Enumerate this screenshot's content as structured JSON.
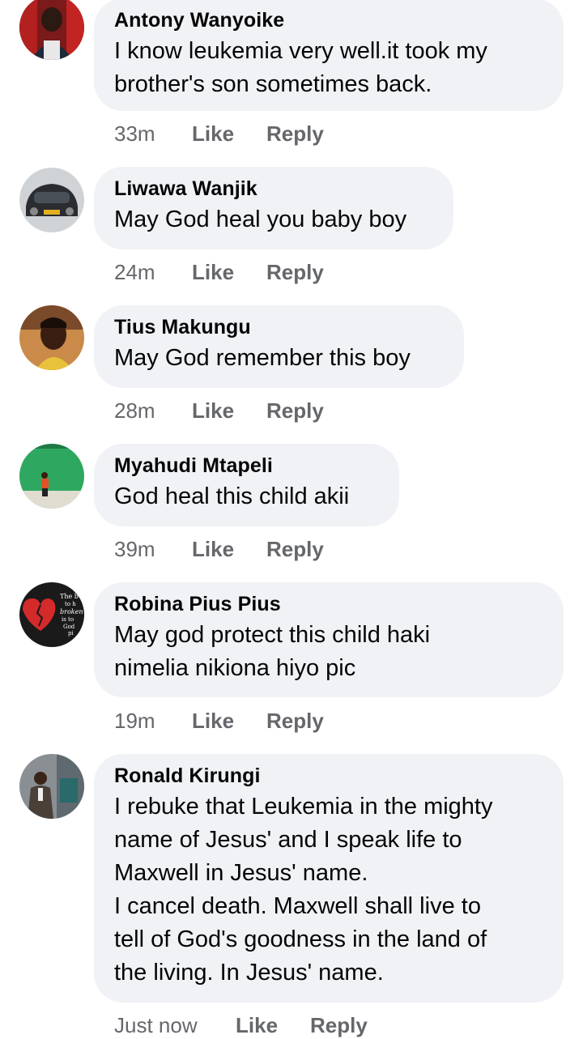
{
  "comments": [
    {
      "author": "Antony Wanyoike",
      "text": "I know leukemia very well.it took my\nbrother's son sometimes back.",
      "time": "33m",
      "like": "Like",
      "reply": "Reply"
    },
    {
      "author": "Liwawa Wanjik",
      "text": "May God heal you baby boy",
      "time": "24m",
      "like": "Like",
      "reply": "Reply"
    },
    {
      "author": "Tius Makungu",
      "text": "May God remember this boy",
      "time": "28m",
      "like": "Like",
      "reply": "Reply"
    },
    {
      "author": "Myahudi Mtapeli",
      "text": "God heal this child akii",
      "time": "39m",
      "like": "Like",
      "reply": "Reply"
    },
    {
      "author": "Robina Pius Pius",
      "text": "May god protect this child haki\nnimelia nikiona hiyo pic",
      "time": "19m",
      "like": "Like",
      "reply": "Reply",
      "avatar_text": "The b to h broken is to God pi"
    },
    {
      "author": "Ronald Kirungi",
      "text": "I rebuke that Leukemia in the mighty\nname of Jesus' and I speak life to\nMaxwell in Jesus' name.\nI cancel death. Maxwell shall live to\ntell of God's goodness in the land of\nthe living. In Jesus' name.",
      "time": "Just now",
      "like": "Like",
      "reply": "Reply"
    }
  ],
  "colors": {
    "bubble": "#f0f2f5",
    "text": "#050505",
    "meta": "#65676b"
  }
}
